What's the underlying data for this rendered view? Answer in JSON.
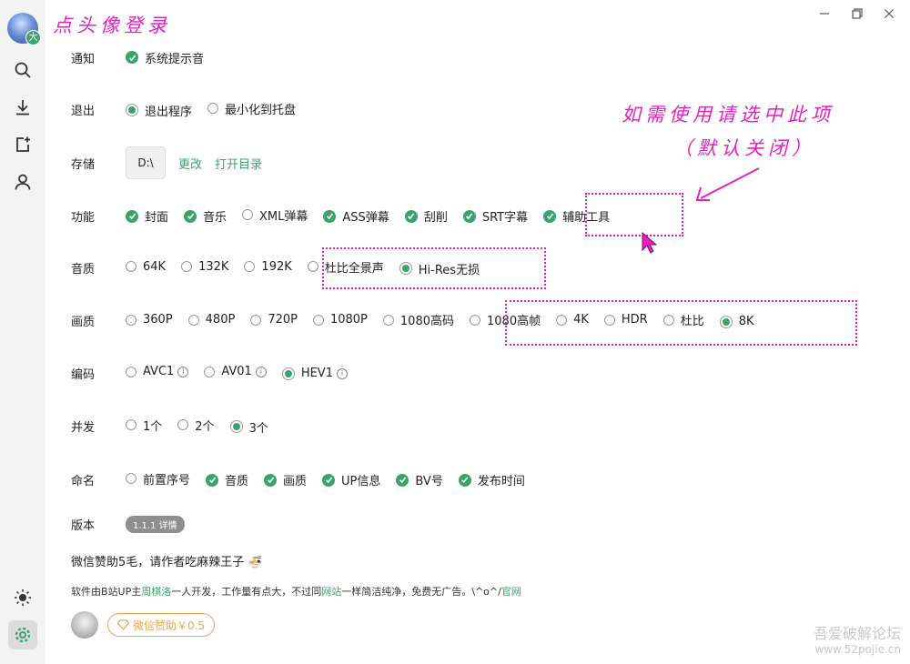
{
  "app": {
    "avatar_badge": "大",
    "login_hint": "点头像登录",
    "accent_color": "#3aa36b",
    "annotation_color": "#e61ec4",
    "sidebar": [
      "search-icon",
      "download-icon",
      "add-file-icon",
      "user-icon",
      "sun-icon",
      "gear-icon"
    ],
    "window_controls": [
      "minimize-icon",
      "maximize-icon",
      "close-icon"
    ]
  },
  "settings": {
    "notify": {
      "label": "通知",
      "options": [
        {
          "text": "系统提示音",
          "state": "checked"
        }
      ]
    },
    "exit": {
      "label": "退出",
      "options": [
        {
          "text": "退出程序",
          "state": "selected"
        },
        {
          "text": "最小化到托盘",
          "state": "off"
        }
      ]
    },
    "storage": {
      "label": "存储",
      "path": "D:\\",
      "change_link": "更改",
      "open_link": "打开目录"
    },
    "features": {
      "label": "功能",
      "options": [
        {
          "text": "封面",
          "state": "checked"
        },
        {
          "text": "音乐",
          "state": "checked"
        },
        {
          "text": "XML弹幕",
          "state": "off"
        },
        {
          "text": "ASS弹幕",
          "state": "checked"
        },
        {
          "text": "刮削",
          "state": "checked"
        },
        {
          "text": "SRT字幕",
          "state": "checked"
        },
        {
          "text": "辅助工具",
          "state": "checked"
        }
      ]
    },
    "audio": {
      "label": "音质",
      "options": [
        {
          "text": "64K",
          "state": "off"
        },
        {
          "text": "132K",
          "state": "off"
        },
        {
          "text": "192K",
          "state": "off"
        },
        {
          "text": "杜比全景声",
          "state": "off"
        },
        {
          "text": "Hi-Res无损",
          "state": "selected"
        }
      ]
    },
    "video": {
      "label": "画质",
      "options": [
        {
          "text": "360P",
          "state": "off"
        },
        {
          "text": "480P",
          "state": "off"
        },
        {
          "text": "720P",
          "state": "off"
        },
        {
          "text": "1080P",
          "state": "off"
        },
        {
          "text": "1080高码",
          "state": "off"
        },
        {
          "text": "1080高帧",
          "state": "off"
        },
        {
          "text": "4K",
          "state": "off"
        },
        {
          "text": "HDR",
          "state": "off"
        },
        {
          "text": "杜比",
          "state": "off"
        },
        {
          "text": "8K",
          "state": "selected"
        }
      ]
    },
    "codec": {
      "label": "编码",
      "options": [
        {
          "text": "AVC1",
          "state": "off",
          "info": "i"
        },
        {
          "text": "AV01",
          "state": "off",
          "info": "i"
        },
        {
          "text": "HEV1",
          "state": "selected",
          "info": "i"
        }
      ]
    },
    "concurrency": {
      "label": "并发",
      "options": [
        {
          "text": "1个",
          "state": "off"
        },
        {
          "text": "2个",
          "state": "off"
        },
        {
          "text": "3个",
          "state": "selected"
        }
      ]
    },
    "naming": {
      "label": "命名",
      "options": [
        {
          "text": "前置序号",
          "state": "off"
        },
        {
          "text": "音质",
          "state": "checked"
        },
        {
          "text": "画质",
          "state": "checked"
        },
        {
          "text": "UP信息",
          "state": "checked"
        },
        {
          "text": "BV号",
          "state": "checked"
        },
        {
          "text": "发布时间",
          "state": "checked"
        }
      ]
    },
    "version": {
      "label": "版本",
      "badge": "1.1.1 详情"
    }
  },
  "footer": {
    "sponsor_line": "微信赞助5毛，请作者吃麻辣王子 🍜",
    "about_prefix": "软件由B站UP主",
    "author": "周棋洛",
    "about_mid": "一人开发，工作量有点大，不过同",
    "site_link": "网站",
    "about_suffix": "一样简洁纯净，免费无广告。\\^o^/",
    "official_link": "官网",
    "sponsor_button": "微信赞助￥0.5"
  },
  "annotations": {
    "tip_line1": "如需使用请选中此项",
    "tip_line2": "（默认关闭）"
  },
  "watermark": {
    "line1": "吾爱破解论坛",
    "line2": "www.52pojie.cn"
  }
}
